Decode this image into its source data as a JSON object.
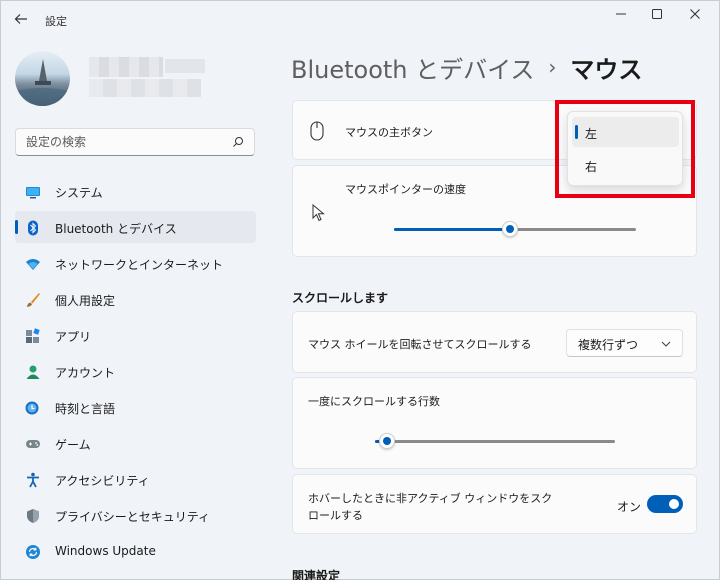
{
  "window": {
    "app_title": "設定",
    "controls": {
      "minimize": "minimize-icon",
      "maximize": "maximize-icon",
      "close": "close-icon"
    }
  },
  "sidebar": {
    "search_placeholder": "設定の検索",
    "items": [
      {
        "label": "システム",
        "icon": "system-icon",
        "active": false
      },
      {
        "label": "Bluetooth とデバイス",
        "icon": "bluetooth-icon",
        "active": true
      },
      {
        "label": "ネットワークとインターネット",
        "icon": "network-icon",
        "active": false
      },
      {
        "label": "個人用設定",
        "icon": "brush-icon",
        "active": false
      },
      {
        "label": "アプリ",
        "icon": "apps-icon",
        "active": false
      },
      {
        "label": "アカウント",
        "icon": "account-icon",
        "active": false
      },
      {
        "label": "時刻と言語",
        "icon": "time-language-icon",
        "active": false
      },
      {
        "label": "ゲーム",
        "icon": "gamepad-icon",
        "active": false
      },
      {
        "label": "アクセシビリティ",
        "icon": "accessibility-icon",
        "active": false
      },
      {
        "label": "プライバシーとセキュリティ",
        "icon": "shield-icon",
        "active": false
      },
      {
        "label": "Windows Update",
        "icon": "windows-update-icon",
        "active": false
      }
    ]
  },
  "breadcrumb": {
    "parent": "Bluetooth とデバイス",
    "separator": "›",
    "current": "マウス"
  },
  "primary_button": {
    "label": "マウスの主ボタン",
    "options": [
      "左",
      "右"
    ],
    "selected": "左"
  },
  "pointer_speed": {
    "label": "マウスポインターの速度",
    "value_fraction": 0.48
  },
  "scroll_section": {
    "title": "スクロールします",
    "wheel": {
      "label": "マウス ホイールを回転させてスクロールする",
      "value": "複数行ずつ"
    },
    "lines": {
      "label": "一度にスクロールする行数",
      "value_fraction": 0.05
    },
    "inactive": {
      "label_line1": "ホバーしたときに非アクティブ ウィンドウをスク",
      "label_line2": "ロールする",
      "state": "オン",
      "on": true
    }
  },
  "related_title": "関連設定",
  "colors": {
    "accent": "#005fb8",
    "highlight": "#e60012"
  }
}
